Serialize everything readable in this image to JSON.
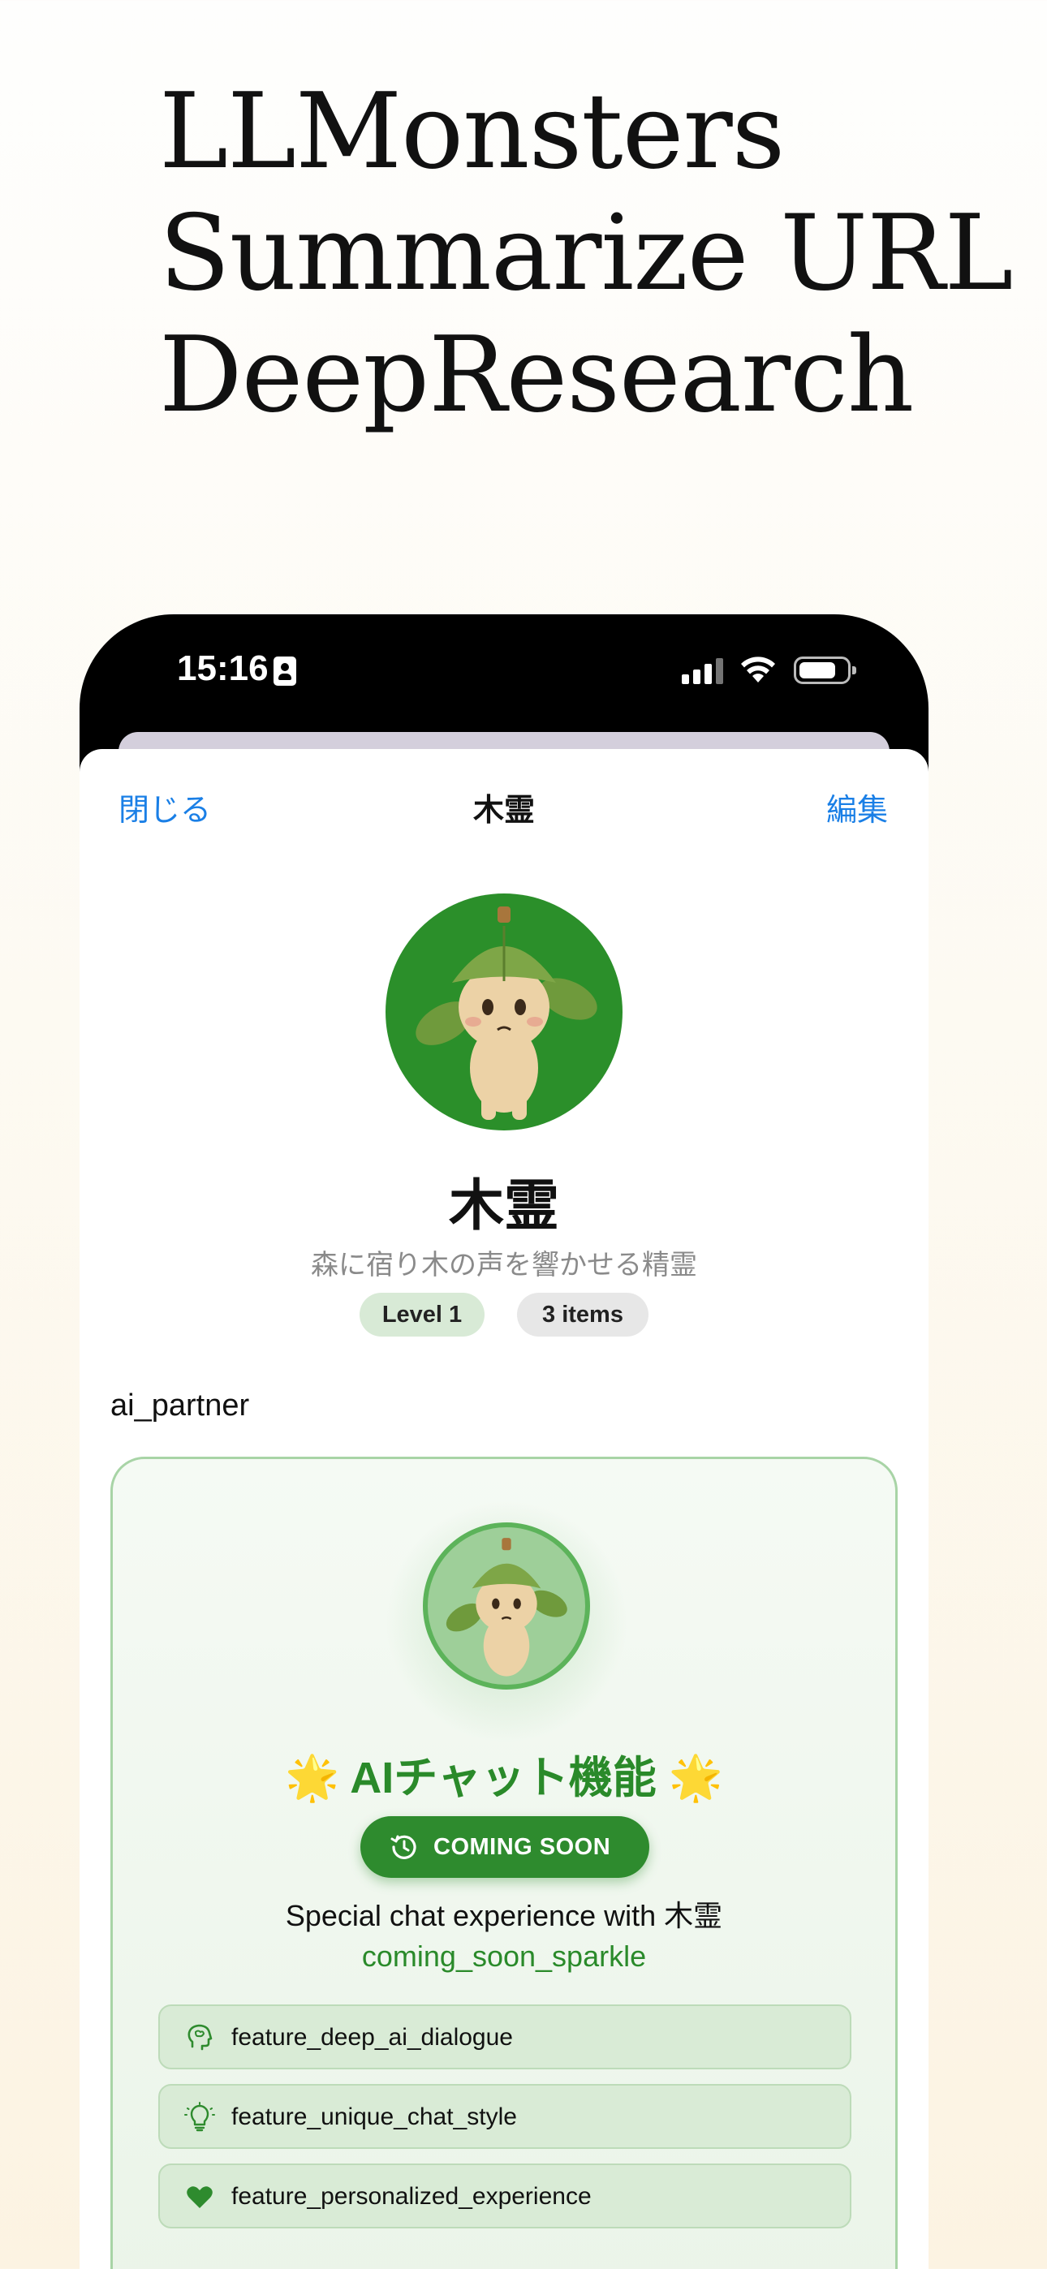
{
  "headline": {
    "line1": "LLMonsters",
    "line2": "Summarize URL",
    "line3": "DeepResearch"
  },
  "status_bar": {
    "time": "15:16"
  },
  "nav": {
    "close_label": "閉じる",
    "title": "木霊",
    "edit_label": "編集"
  },
  "profile": {
    "name": "木霊",
    "subtitle": "森に宿り木の声を響かせる精霊",
    "level_badge": "Level 1",
    "items_badge": "3 items"
  },
  "section": {
    "title": "ai_partner"
  },
  "ai_card": {
    "title_star_left": "🌟",
    "title": "AIチャット機能",
    "title_star_right": "🌟",
    "coming_soon_label": "COMING SOON",
    "description": "Special chat experience with 木霊",
    "sparkle_text": "coming_soon_sparkle",
    "features": [
      {
        "label": "feature_deep_ai_dialogue",
        "icon": "brain-icon"
      },
      {
        "label": "feature_unique_chat_style",
        "icon": "lightbulb-icon"
      },
      {
        "label": "feature_personalized_experience",
        "icon": "heart-icon"
      }
    ]
  },
  "colors": {
    "accent_blue": "#1a7fe6",
    "accent_green": "#2e8b2e",
    "avatar_green": "#2b8f2a"
  }
}
